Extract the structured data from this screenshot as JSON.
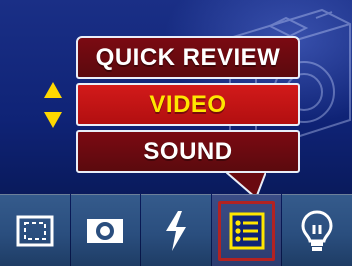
{
  "menu": {
    "items": [
      {
        "label": "QUICK REVIEW",
        "selected": false
      },
      {
        "label": "VIDEO",
        "selected": true
      },
      {
        "label": "SOUND",
        "selected": false
      }
    ],
    "scroll_indicator_icon": "up-down-arrows-icon",
    "accent_color_selected_text": "#ffe600",
    "selected_bg_color": "#c81414",
    "unselected_bg_color": "#6a0a10"
  },
  "toolbar": {
    "buttons": [
      {
        "icon": "framing-icon",
        "selected": false
      },
      {
        "icon": "camera-mode-icon",
        "selected": false
      },
      {
        "icon": "flash-icon",
        "selected": false
      },
      {
        "icon": "menu-list-icon",
        "selected": true
      },
      {
        "icon": "lightbulb-icon",
        "selected": false
      }
    ]
  },
  "background": {
    "watermark_icon": "camera-icon"
  }
}
